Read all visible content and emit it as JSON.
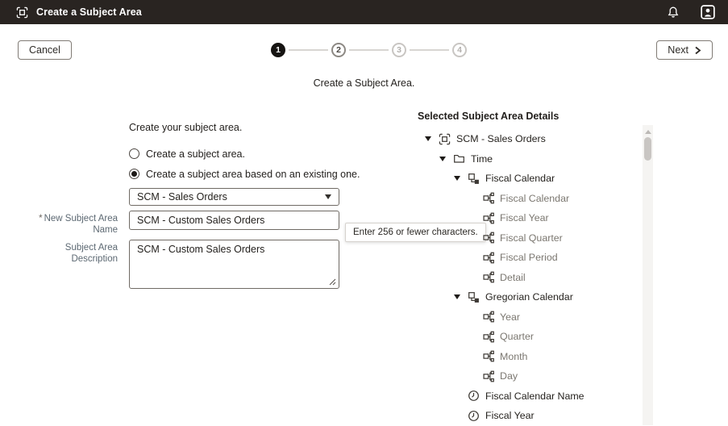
{
  "header": {
    "title": "Create a Subject Area",
    "app_icon": "subject-area-icon",
    "right_icons": [
      "bell-icon",
      "user-avatar-icon"
    ]
  },
  "toolbar": {
    "cancel_label": "Cancel",
    "next_label": "Next"
  },
  "stepper": {
    "steps": [
      {
        "number": "1",
        "state": "current"
      },
      {
        "number": "2",
        "state": "next"
      },
      {
        "number": "3",
        "state": "future"
      },
      {
        "number": "4",
        "state": "future"
      }
    ]
  },
  "subtitle": "Create a Subject Area.",
  "form": {
    "heading": "Create your subject area.",
    "radios": [
      {
        "label": "Create a subject area.",
        "selected": false
      },
      {
        "label": "Create a subject area based on an existing one.",
        "selected": true
      }
    ],
    "source_select": {
      "value": "SCM - Sales Orders"
    },
    "name_field": {
      "label": "New Subject Area Name",
      "required": true,
      "value": "SCM - Custom Sales Orders"
    },
    "name_tooltip": "Enter 256 or fewer characters.",
    "description_field": {
      "label": "Subject Area Description",
      "value": "SCM - Custom Sales Orders"
    }
  },
  "tree": {
    "title": "Selected Subject Area Details",
    "rows": [
      {
        "label": "SCM - Sales Orders",
        "level": 0,
        "expanded": true,
        "icon": "subject-area-icon",
        "muted": false
      },
      {
        "label": "Time",
        "level": 1,
        "expanded": true,
        "icon": "folder-icon",
        "muted": false
      },
      {
        "label": "Fiscal Calendar",
        "level": 2,
        "expanded": true,
        "icon": "hierarchy-icon",
        "muted": false
      },
      {
        "label": "Fiscal Calendar",
        "level": 3,
        "expanded": false,
        "icon": "level-icon",
        "muted": true
      },
      {
        "label": "Fiscal Year",
        "level": 3,
        "expanded": false,
        "icon": "level-icon",
        "muted": true
      },
      {
        "label": "Fiscal Quarter",
        "level": 3,
        "expanded": false,
        "icon": "level-icon",
        "muted": true
      },
      {
        "label": "Fiscal Period",
        "level": 3,
        "expanded": false,
        "icon": "level-icon",
        "muted": true
      },
      {
        "label": "Detail",
        "level": 3,
        "expanded": false,
        "icon": "level-icon",
        "muted": true
      },
      {
        "label": "Gregorian Calendar",
        "level": 2,
        "expanded": true,
        "icon": "hierarchy-icon",
        "muted": false
      },
      {
        "label": "Year",
        "level": 3,
        "expanded": false,
        "icon": "level-icon",
        "muted": true
      },
      {
        "label": "Quarter",
        "level": 3,
        "expanded": false,
        "icon": "level-icon",
        "muted": true
      },
      {
        "label": "Month",
        "level": 3,
        "expanded": false,
        "icon": "level-icon",
        "muted": true
      },
      {
        "label": "Day",
        "level": 3,
        "expanded": false,
        "icon": "level-icon",
        "muted": true
      },
      {
        "label": "Fiscal Calendar Name",
        "level": 2,
        "expanded": false,
        "icon": "clock-icon",
        "muted": false
      },
      {
        "label": "Fiscal Year",
        "level": 2,
        "expanded": false,
        "icon": "clock-icon",
        "muted": false
      }
    ]
  },
  "colors": {
    "titlebar_bg": "#292421",
    "accent_dark": "#161412",
    "text": "#25221e",
    "muted_text": "#7b7770",
    "label": "#5c6872",
    "input_border": "#6f6a64",
    "tooltip_border": "#d6d2ce",
    "connector": "#d8d5d2",
    "scroll_track": "#f5f4f2",
    "scroll_thumb": "#c9c6c3"
  }
}
